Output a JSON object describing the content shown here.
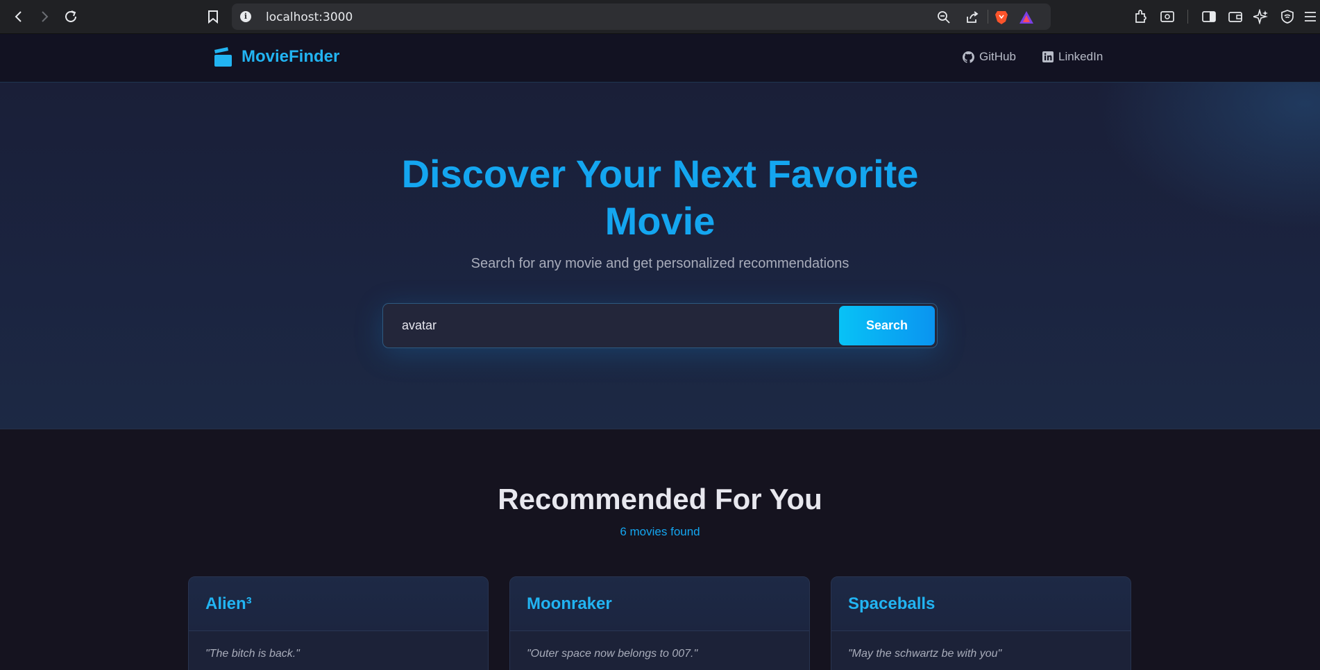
{
  "browser": {
    "url": "localhost:3000"
  },
  "site": {
    "brand": "MovieFinder",
    "nav": [
      {
        "label": "GitHub",
        "icon": "github-icon"
      },
      {
        "label": "LinkedIn",
        "icon": "linkedin-icon"
      }
    ]
  },
  "hero": {
    "title_line1": "Discover Your Next Favorite",
    "title_line2": "Movie",
    "subtitle": "Search for any movie and get personalized recommendations",
    "search_value": "avatar",
    "search_button": "Search"
  },
  "recommendations": {
    "title": "Recommended For You",
    "count_text": "6 movies found",
    "movies": [
      {
        "title": "Alien³",
        "tagline": "\"The bitch is back.\""
      },
      {
        "title": "Moonraker",
        "tagline": "\"Outer space now belongs to 007.\""
      },
      {
        "title": "Spaceballs",
        "tagline": "\"May the schwartz be with you\""
      }
    ]
  },
  "colors": {
    "accent": "#14a6f0",
    "background": "#15131f",
    "hero_background": "#1b2440",
    "card_background": "#1c2238"
  }
}
